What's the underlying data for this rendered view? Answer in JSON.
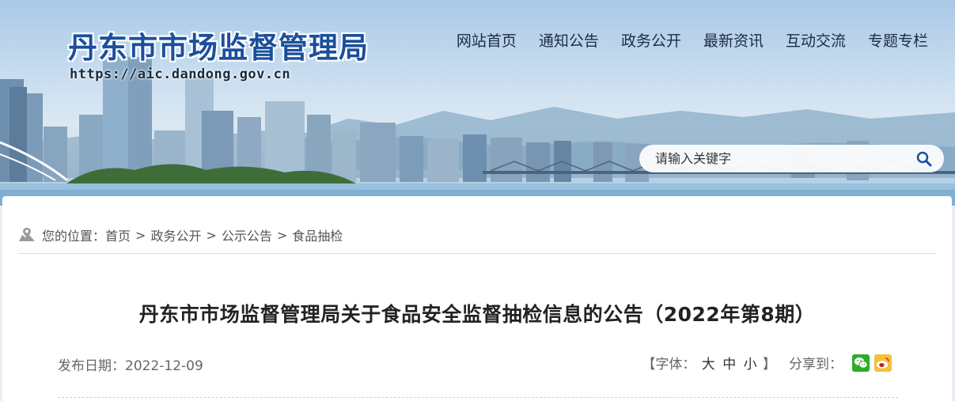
{
  "site": {
    "title": "丹东市市场监督管理局",
    "url": "https://aic.dandong.gov.cn"
  },
  "nav": {
    "items": [
      {
        "label": "网站首页"
      },
      {
        "label": "通知公告"
      },
      {
        "label": "政务公开"
      },
      {
        "label": "最新资讯"
      },
      {
        "label": "互动交流"
      },
      {
        "label": "专题专栏"
      }
    ]
  },
  "search": {
    "placeholder": "请输入关键字",
    "icon": "search-icon"
  },
  "breadcrumb": {
    "prefix": "您的位置：",
    "items": [
      {
        "label": "首页"
      },
      {
        "label": "政务公开"
      },
      {
        "label": "公示公告"
      },
      {
        "label": "食品抽检"
      }
    ],
    "separator": ">"
  },
  "article": {
    "title": "丹东市市场监督管理局关于食品安全监督抽检信息的公告（2022年第8期）",
    "date_label": "发布日期：",
    "date": "2022-12-09",
    "font_label_open": "【字体：",
    "font_large": "大",
    "font_medium": "中",
    "font_small": "小",
    "font_label_close": "】",
    "share_label": "分享到："
  },
  "colors": {
    "title_blue": "#1a4f9c",
    "wechat_green": "#2bad2b",
    "weibo_yellow": "#f3c13a"
  }
}
